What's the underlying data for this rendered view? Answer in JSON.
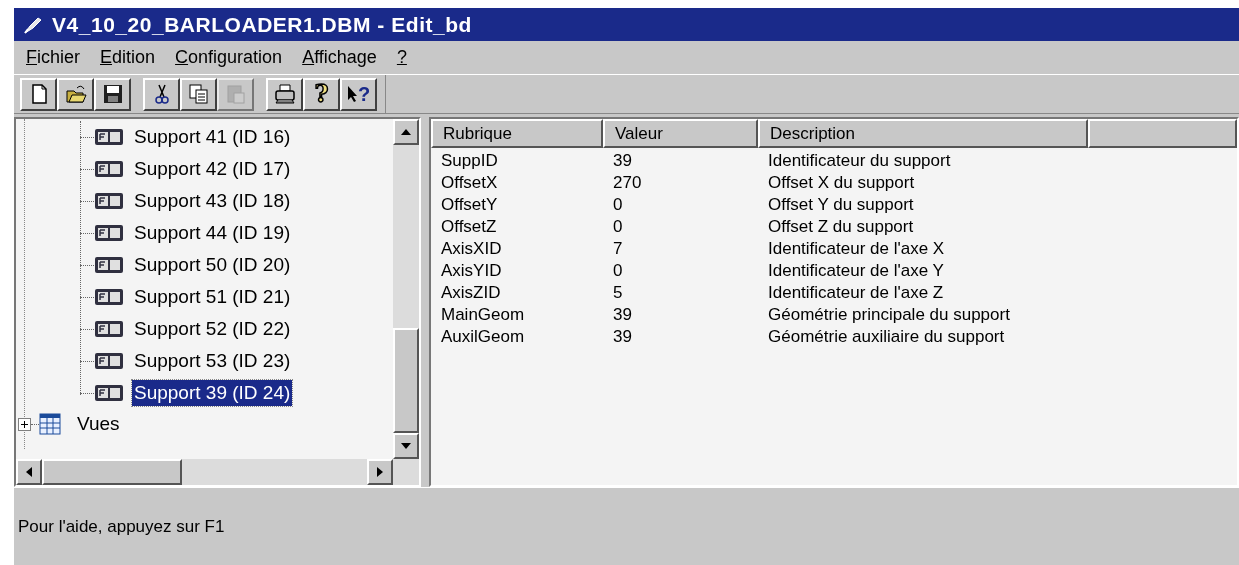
{
  "window": {
    "title": "V4_10_20_BARLOADER1.DBM - Edit_bd"
  },
  "menu": [
    {
      "label": "Fichier"
    },
    {
      "label": "Edition"
    },
    {
      "label": "Configuration"
    },
    {
      "label": "Affichage"
    },
    {
      "label": "?"
    }
  ],
  "toolbar": [
    {
      "kind": "new",
      "disabled": false
    },
    {
      "kind": "open",
      "disabled": false
    },
    {
      "kind": "save",
      "disabled": false
    },
    {
      "kind": "separator"
    },
    {
      "kind": "cut",
      "disabled": false
    },
    {
      "kind": "copy",
      "disabled": false
    },
    {
      "kind": "paste",
      "disabled": true
    },
    {
      "kind": "separator"
    },
    {
      "kind": "print",
      "disabled": false
    },
    {
      "kind": "help",
      "glyph": "?",
      "disabled": false
    },
    {
      "kind": "context_help",
      "glyph": "?",
      "disabled": false
    }
  ],
  "tree": {
    "items": [
      {
        "children": [
          {
            "label": "Support 41 (ID 16)",
            "selected": false
          },
          {
            "label": "Support 42 (ID 17)",
            "selected": false
          },
          {
            "label": "Support 43 (ID 18)",
            "selected": false
          },
          {
            "label": "Support 44 (ID 19)",
            "selected": false
          },
          {
            "label": "Support 50 (ID 20)",
            "selected": false
          },
          {
            "label": "Support 51 (ID 21)",
            "selected": false
          },
          {
            "label": "Support 52 (ID 22)",
            "selected": false
          },
          {
            "label": "Support 53 (ID 23)",
            "selected": false
          },
          {
            "label": "Support 39 (ID 24)",
            "selected": true
          }
        ]
      },
      {
        "label": "Vues",
        "expanded": false,
        "selected": false
      }
    ]
  },
  "table": {
    "columns": [
      "Rubrique",
      "Valeur",
      "Description"
    ],
    "rows": [
      [
        "SuppID",
        "39",
        "Identificateur du support"
      ],
      [
        "OffsetX",
        "270",
        "Offset X du support"
      ],
      [
        "OffsetY",
        "0",
        "Offset Y du support"
      ],
      [
        "OffsetZ",
        "0",
        "Offset Z du support"
      ],
      [
        "AxisXID",
        "7",
        "Identificateur de l'axe X"
      ],
      [
        "AxisYID",
        "0",
        "Identificateur de l'axe Y"
      ],
      [
        "AxisZID",
        "5",
        "Identificateur de l'axe Z"
      ],
      [
        "MainGeom",
        "39",
        "Géométrie principale du support"
      ],
      [
        "AuxilGeom",
        "39",
        "Géométrie auxiliaire du support"
      ]
    ]
  },
  "status_bar": "Pour l'aide, appuyez sur F1"
}
